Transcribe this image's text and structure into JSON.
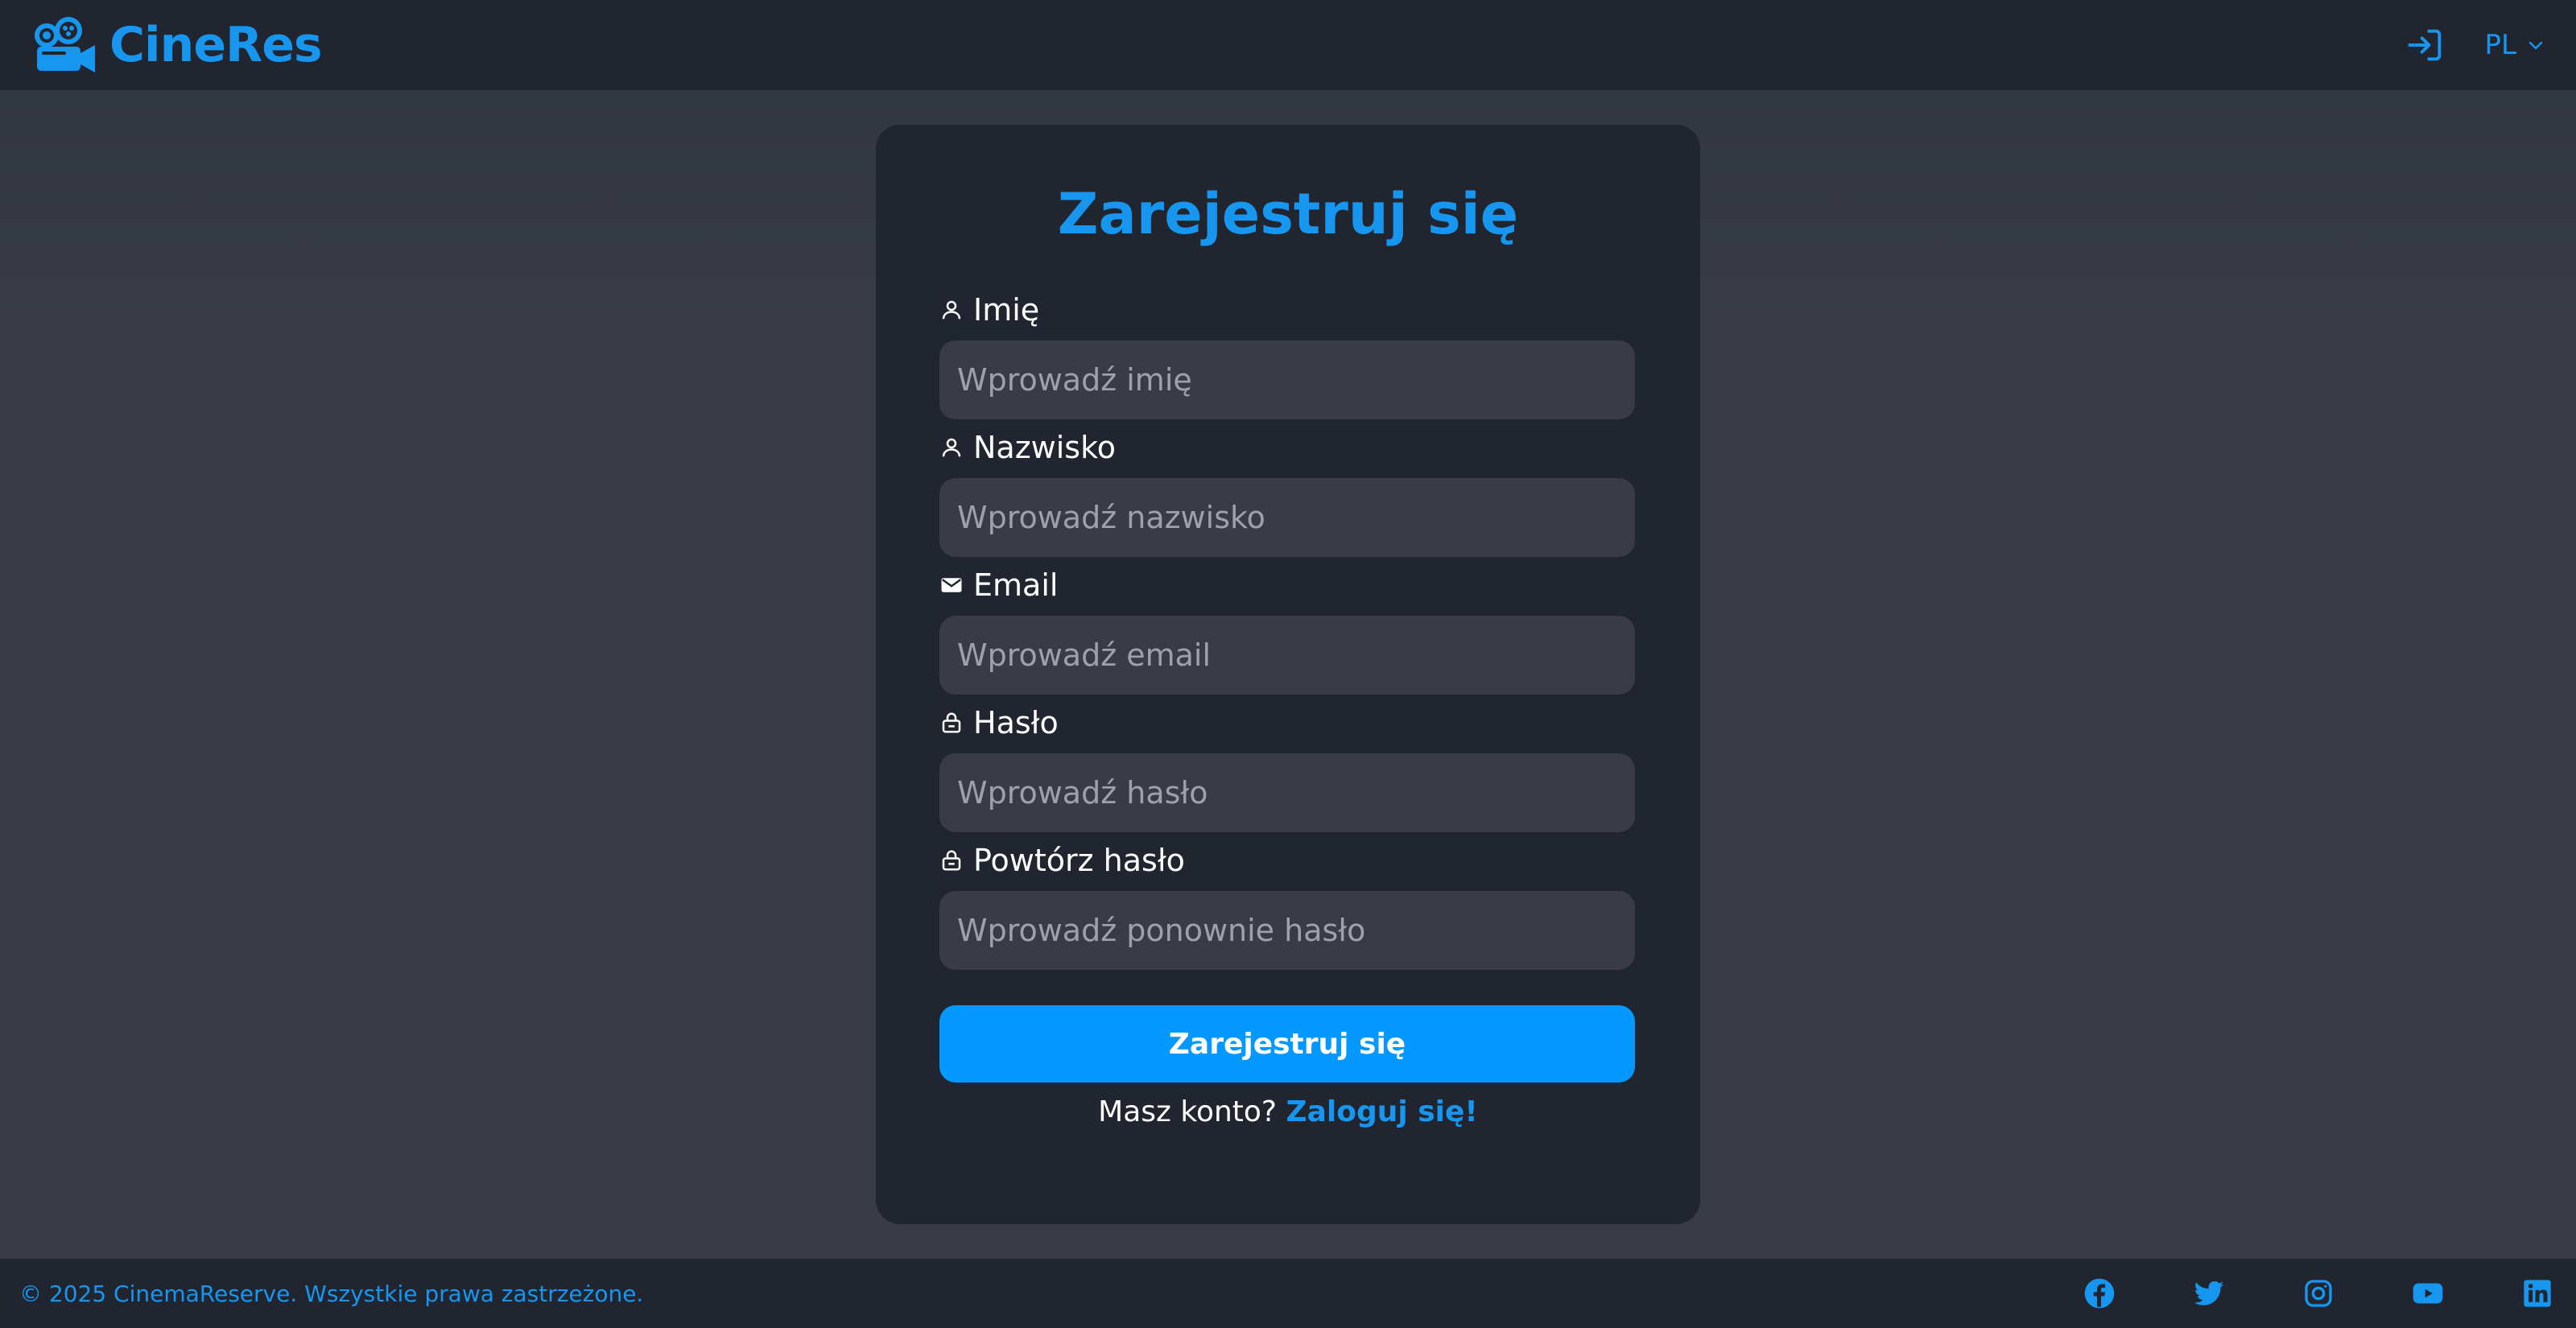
{
  "header": {
    "brand": "CineRes",
    "login_icon": "login-icon",
    "language": "PL",
    "language_chevron": "chevron-down-icon"
  },
  "form": {
    "title": "Zarejestruj się",
    "fields": [
      {
        "label": "Imię",
        "placeholder": "Wprowadź imię",
        "value": "",
        "icon": "user-icon"
      },
      {
        "label": "Nazwisko",
        "placeholder": "Wprowadź nazwisko",
        "value": "",
        "icon": "user-icon"
      },
      {
        "label": "Email",
        "placeholder": "Wprowadź email",
        "value": "",
        "icon": "envelope-icon"
      },
      {
        "label": "Hasło",
        "placeholder": "Wprowadź hasło",
        "value": "",
        "icon": "lock-icon"
      },
      {
        "label": "Powtórz hasło",
        "placeholder": "Wprowadź ponownie hasło",
        "value": "",
        "icon": "lock-icon"
      }
    ],
    "submit_label": "Zarejestruj się",
    "login_prompt": "Masz konto?",
    "login_link": "Zaloguj się!"
  },
  "footer": {
    "copyright": "© 2025 CinemaReserve. Wszystkie prawa zastrzeżone.",
    "socials": [
      "facebook-icon",
      "twitter-icon",
      "instagram-icon",
      "youtube-icon",
      "linkedin-icon"
    ]
  },
  "colors": {
    "accent": "#1796f0",
    "button": "#0598ff",
    "panel": "#20252f",
    "background": "#393c47"
  }
}
